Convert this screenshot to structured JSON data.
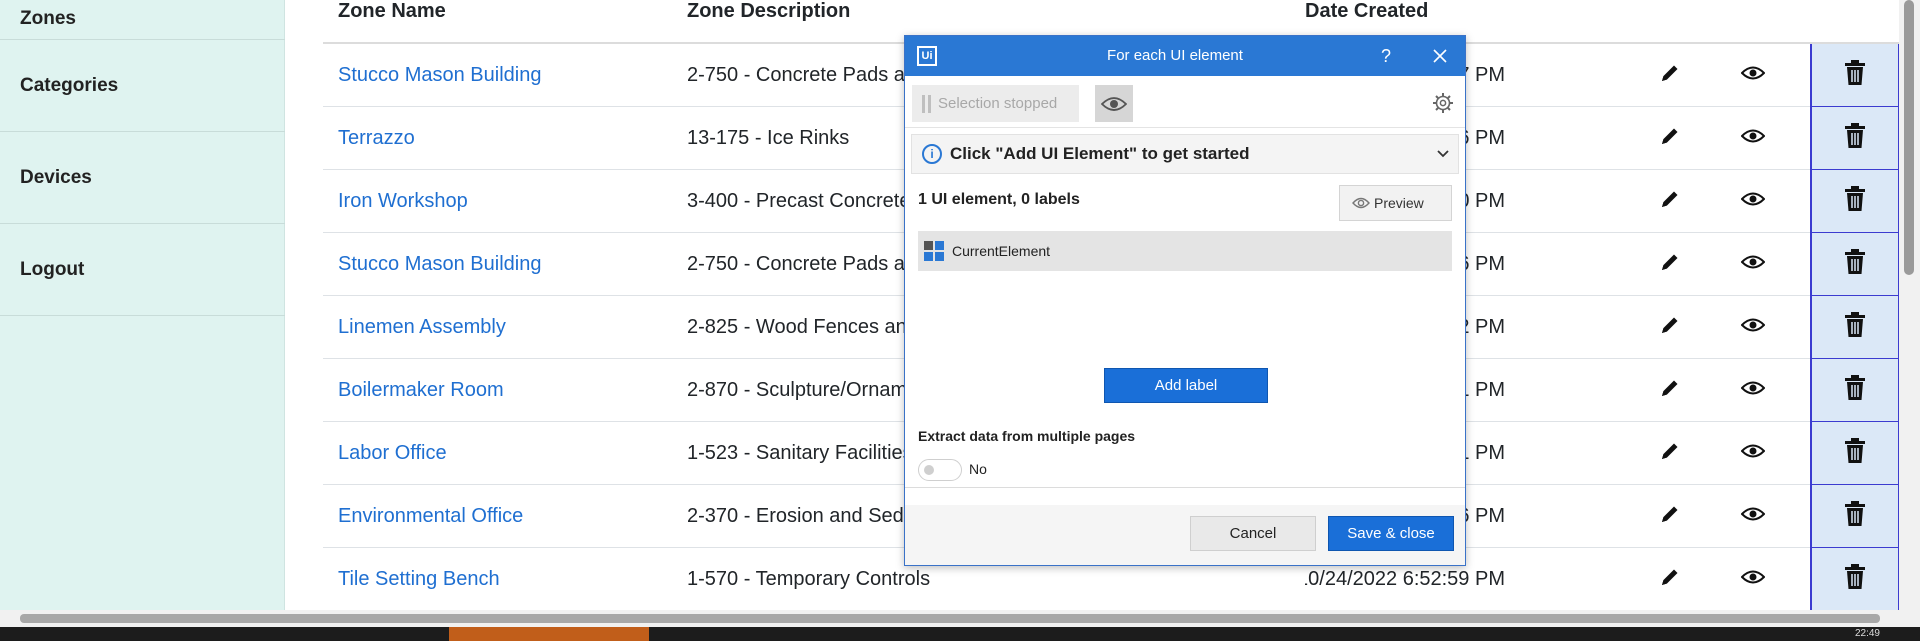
{
  "sidebar": {
    "items": [
      {
        "label": "Zones"
      },
      {
        "label": "Categories"
      },
      {
        "label": "Devices"
      },
      {
        "label": "Logout"
      }
    ]
  },
  "table": {
    "headers": {
      "name": "Zone Name",
      "description": "Zone Description",
      "date": "Date Created"
    },
    "rows": [
      {
        "name": "Stucco Mason Building",
        "description": "2-750 - Concrete Pads ar",
        "date": "7 PM"
      },
      {
        "name": "Terrazzo",
        "description": "13-175 - Ice Rinks",
        "date": "6 PM"
      },
      {
        "name": "Iron Workshop",
        "description": "3-400 - Precast Concrete",
        "date": "0 PM"
      },
      {
        "name": "Stucco Mason Building",
        "description": "2-750 - Concrete Pads ar",
        "date": "6 PM"
      },
      {
        "name": "Linemen Assembly",
        "description": "2-825 - Wood Fences anc",
        "date": "2 PM"
      },
      {
        "name": "Boilermaker Room",
        "description": "2-870 - Sculpture/Ornam",
        "date": "1 PM"
      },
      {
        "name": "Labor Office",
        "description": "1-523 - Sanitary Facilities",
        "date": "1 PM"
      },
      {
        "name": "Environmental Office",
        "description": "2-370 - Erosion and Sedi",
        "date": "6 PM"
      },
      {
        "name": "Tile Setting Bench",
        "description": "1-570 - Temporary Controls",
        "date": "10/24/2022 6:52:59 PM"
      }
    ],
    "icons": {
      "edit": "pencil-icon",
      "view": "eye-icon",
      "delete": "trash-icon"
    }
  },
  "dialog": {
    "logo": "Ui",
    "title": "For each UI element",
    "help": "?",
    "selection_button": "Selection stopped",
    "info_text": "Click \"Add UI Element\" to get started",
    "counts_text": "1 UI element, 0 labels",
    "preview_label": "Preview",
    "element_label": "CurrentElement",
    "add_label_button": "Add label",
    "extract_text": "Extract data from multiple pages",
    "toggle_value": "No",
    "cancel_label": "Cancel",
    "save_label": "Save & close"
  },
  "taskbar": {
    "clock": "22:49"
  },
  "colors": {
    "sidebar_bg": "#dff3f0",
    "link": "#1f6fd1",
    "dialog_title": "#2a78d4",
    "primary_button": "#1a6fd8",
    "delete_column": "#dbe8f7"
  }
}
